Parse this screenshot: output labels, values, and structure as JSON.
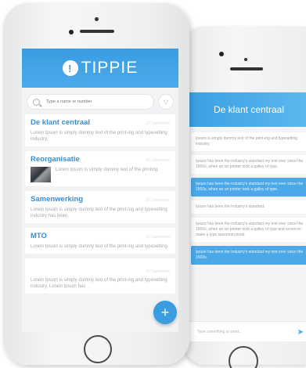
{
  "front": {
    "app_title": "TIPPIE",
    "logo_glyph": "!",
    "search_placeholder": "Type a name or number",
    "filter_glyph": "▽",
    "fab_glyph": "+",
    "cards": [
      {
        "title": "De klant centraal",
        "meta": "10 Comments",
        "text": "Lorem Ipsum is simply dummy text of the print-ing and typesetting industry."
      },
      {
        "title": "Reorganisatie",
        "meta": "10 Comments",
        "text": "Lorem Ipsum is simply dummy text of the printing."
      },
      {
        "title": "Samenwerking",
        "meta": "10 Comments",
        "text": "Lorem Ipsum is simply dummy text of the print-ing and typesetting industry has been."
      },
      {
        "title": "MTO",
        "meta": "10 Comments",
        "text": "Lorem Ipsum is simply dummy text of the print-ing and typesetting."
      },
      {
        "title": "",
        "meta": "10 Comments",
        "text": "Lorem Ipsum is simply dummy text of the print-ing and typesetting industry. Lorem Ipsum has"
      }
    ]
  },
  "back": {
    "header_title": "De klant centraal",
    "messages": [
      {
        "text": "Ipsum is simply dummy text of the print-ing and typesetting industry.",
        "style": "white"
      },
      {
        "text": "Ipsum has been the industry's standard my text ever since the 1500s, when an un-printer took a galley of type.",
        "style": "white"
      },
      {
        "text": "Ipsum has been the industry's standard my text ever since the 1500s, when an un-printer took a galley of type.",
        "style": "blue"
      },
      {
        "text": "Ipsum has been the industry's standard.",
        "style": "white"
      },
      {
        "text": "Ipsum has been the industry's standard my text ever since the 1500s, when an un-printer took a galley of type and scram-to make a type specimen book.",
        "style": "white"
      },
      {
        "text": "Ipsum has been the industry's standard my text ever since the 1500s.",
        "style": "blue"
      }
    ],
    "input_placeholder": "Type something to send...",
    "send_glyph": "➤"
  },
  "colors": {
    "accent": "#3a9de0",
    "title": "#3a8ed4"
  }
}
